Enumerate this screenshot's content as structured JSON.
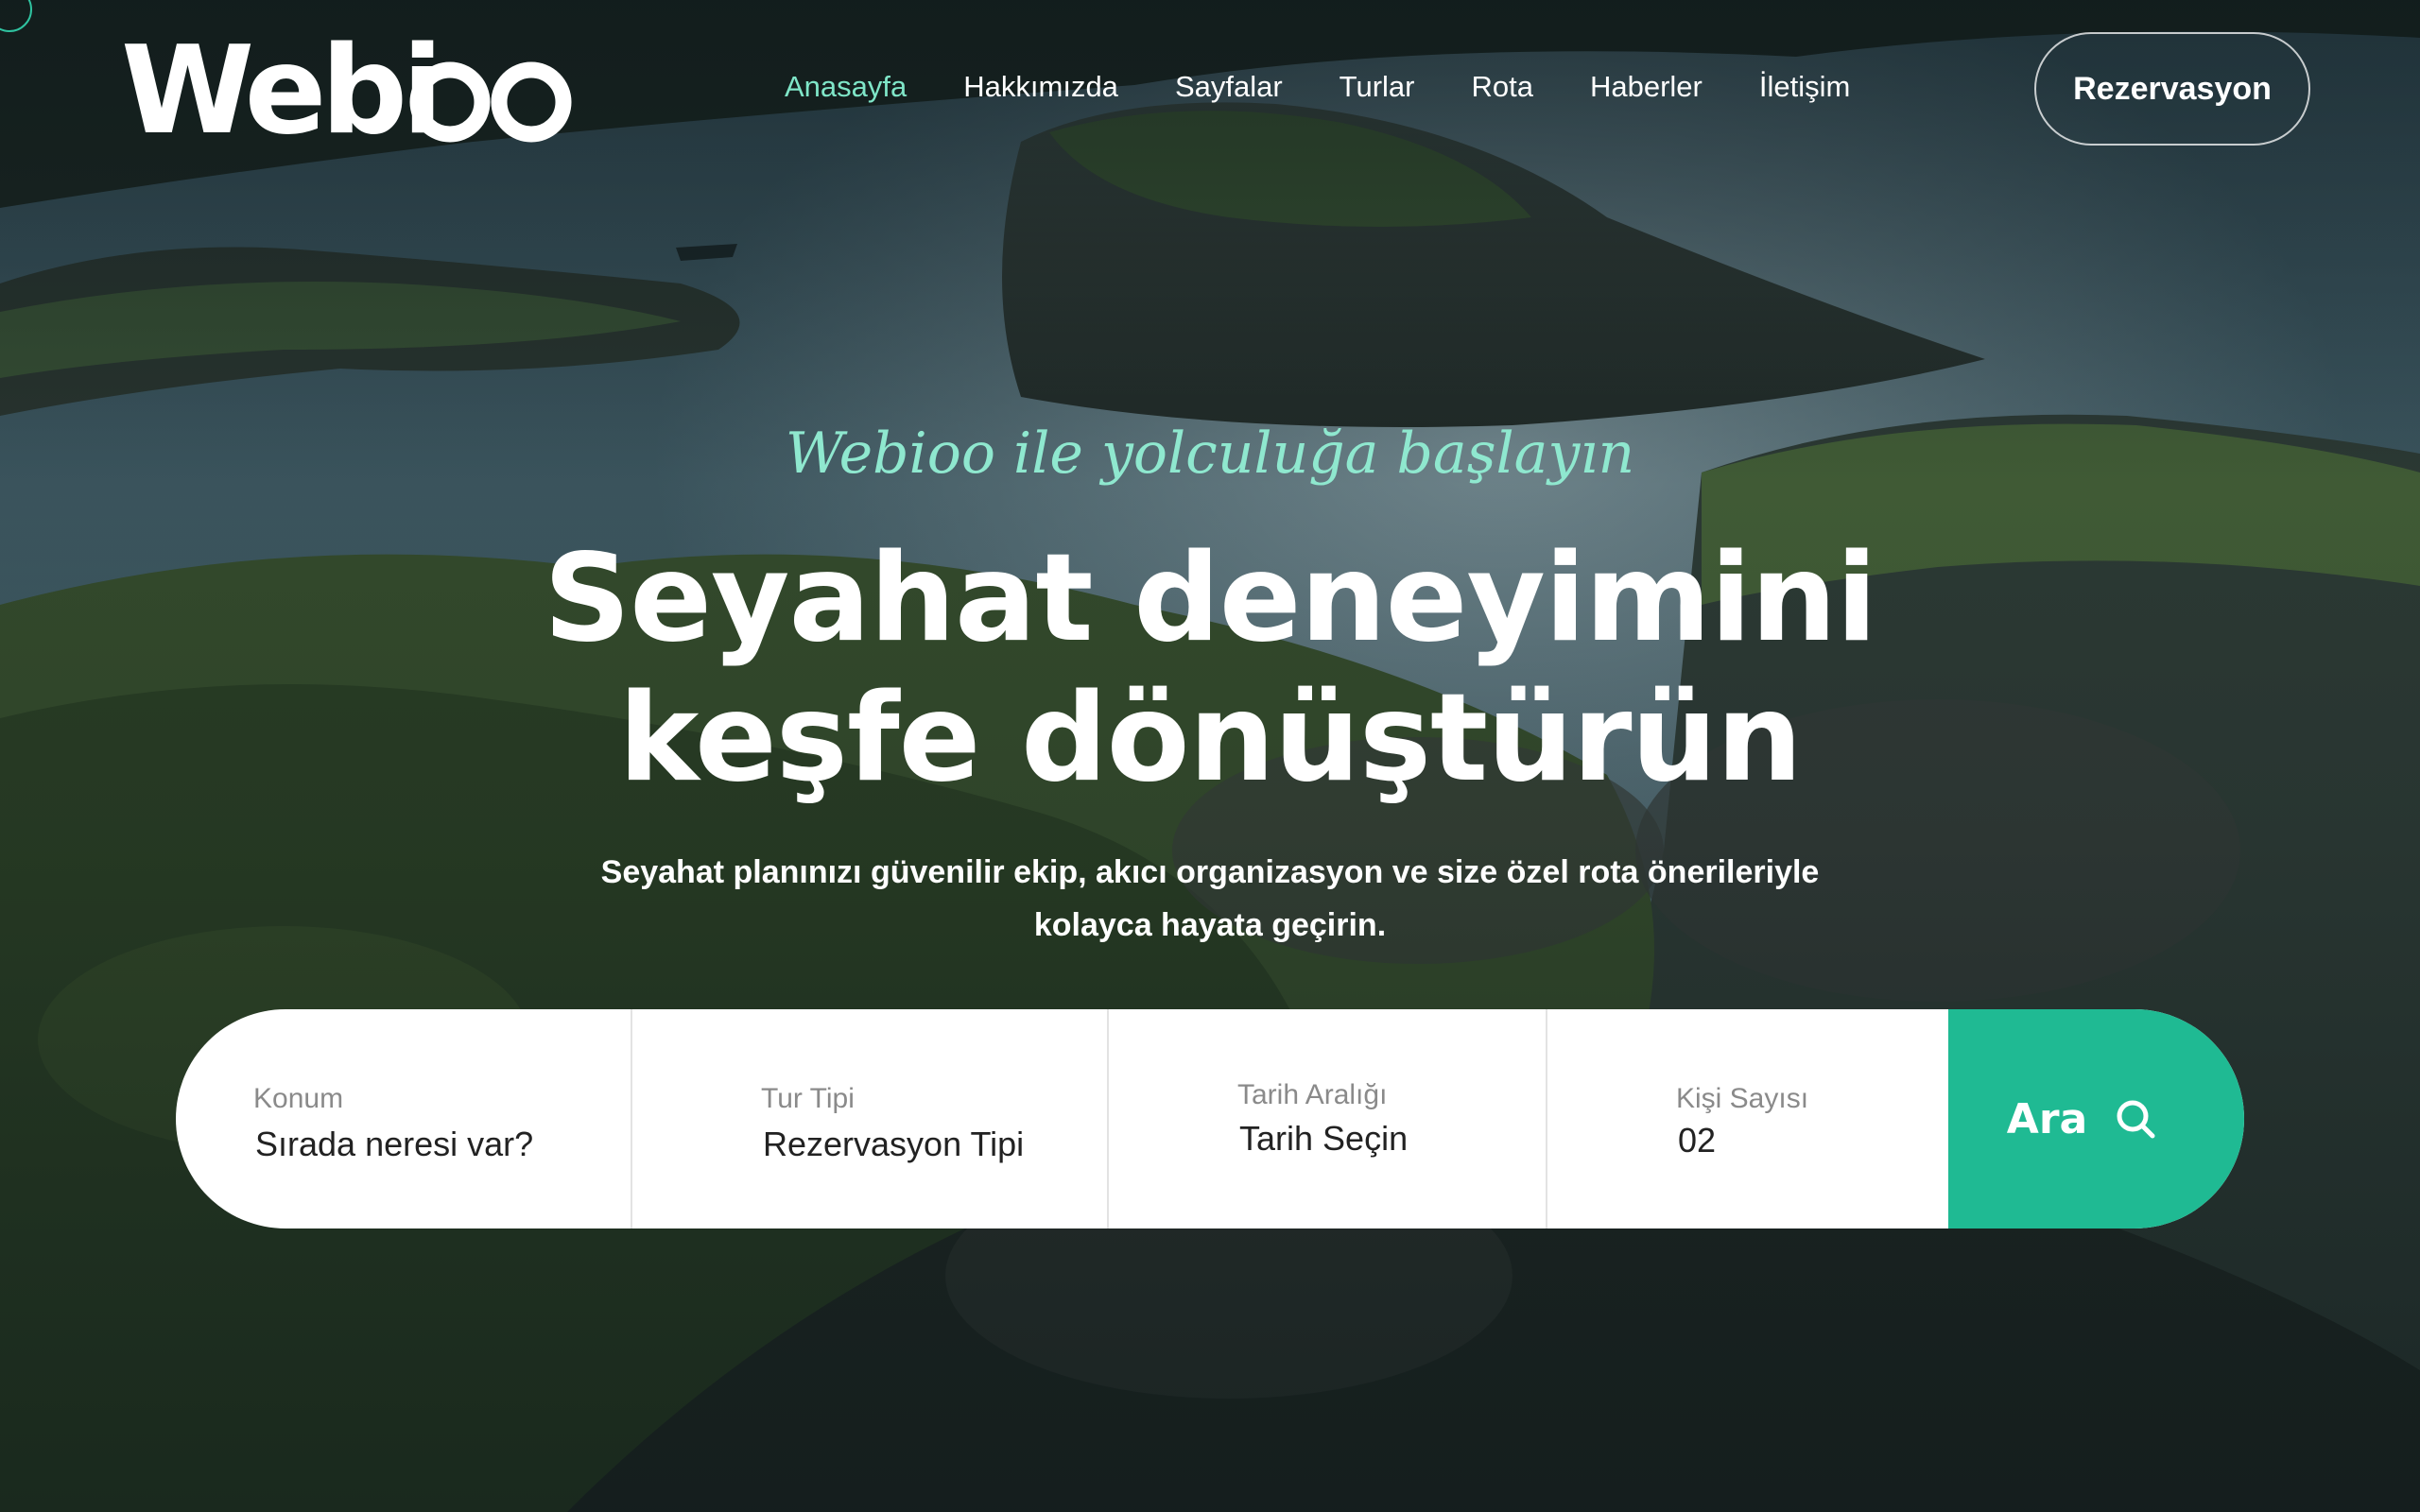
{
  "brand": {
    "logo_text": "Webioo",
    "accent_color": "#1fba93",
    "nav_active_color": "#7fe6c8"
  },
  "nav": {
    "items": [
      {
        "label": "Anasayfa",
        "active": true
      },
      {
        "label": "Hakkımızda",
        "active": false
      },
      {
        "label": "Sayfalar",
        "active": false
      },
      {
        "label": "Turlar",
        "active": false
      },
      {
        "label": "Rota",
        "active": false
      },
      {
        "label": "Haberler",
        "active": false
      },
      {
        "label": "İletişim",
        "active": false
      }
    ],
    "cta_label": "Rezervasyon"
  },
  "hero": {
    "tagline": "Webioo ile yolculuğa başlayın",
    "headline_line1": "Seyahat deneyimini",
    "headline_line2": "keşfe dönüştürün",
    "subtitle": "Seyahat planınızı güvenilir ekip, akıcı organizasyon ve size özel rota önerileriyle kolayca hayata geçirin."
  },
  "search": {
    "location": {
      "label": "Konum",
      "value": "Sırada neresi var?"
    },
    "tour_type": {
      "label": "Tur Tipi",
      "value": "Rezervasyon Tipi"
    },
    "date_range": {
      "label": "Tarih Aralığı",
      "value": "Tarih Seçin"
    },
    "people": {
      "label": "Kişi Sayısı",
      "value": "02"
    },
    "button_label": "Ara",
    "button_icon": "search-icon"
  }
}
